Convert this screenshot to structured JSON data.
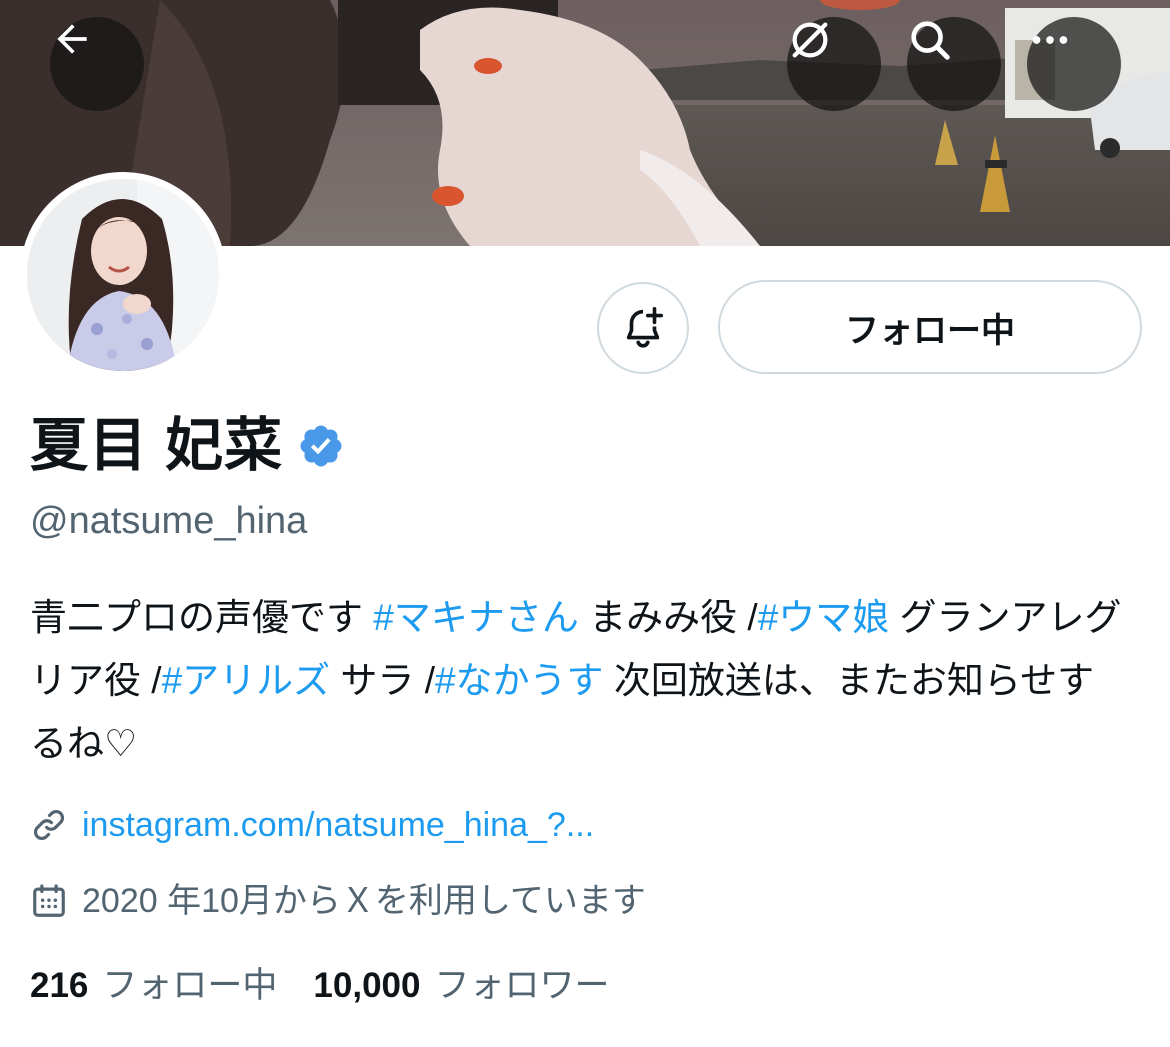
{
  "header": {
    "back_icon": "arrow-left-icon",
    "actions": [
      "satellite-off-icon",
      "search-icon",
      "more-icon"
    ]
  },
  "profile": {
    "display_name": "夏目 妃菜",
    "verified": true,
    "handle": "@natsume_hina",
    "follow_button_label": "フォロー中",
    "notify_icon": "bell-plus-icon",
    "bio_segments": [
      {
        "text": "青二プロの声優です ",
        "tag": false
      },
      {
        "text": "#マキナさん",
        "tag": true
      },
      {
        "text": " まみみ役 /",
        "tag": false
      },
      {
        "text": "#ウマ娘",
        "tag": true
      },
      {
        "text": " グランアレグリア役 /",
        "tag": false
      },
      {
        "text": "#アリルズ",
        "tag": true
      },
      {
        "text": " サラ /",
        "tag": false
      },
      {
        "text": "#なかうす",
        "tag": true
      },
      {
        "text": " 次回放送は、またお知らせするね♡",
        "tag": false
      }
    ],
    "link": "instagram.com/natsume_hina_?...",
    "joined": "2020 年10月からＸを利用しています",
    "following_count": "216",
    "following_label": "フォロー中",
    "followers_count": "10,000",
    "followers_label": "フォロワー"
  },
  "colors": {
    "accent": "#1d9bf0",
    "secondary_text": "#536471",
    "border": "#cfd9de",
    "verified_badge": "#4a99e9"
  }
}
